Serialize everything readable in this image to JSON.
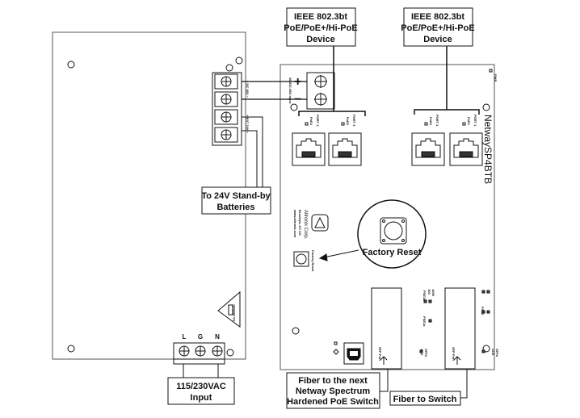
{
  "devices": [
    {
      "line1": "IEEE 802.3bt",
      "line2": "PoE/PoE+/Hi-PoE",
      "line3": "Device"
    },
    {
      "line1": "IEEE 802.3bt",
      "line2": "PoE/PoE+/Hi-PoE",
      "line3": "Device"
    }
  ],
  "psu": {
    "dc_label": "+ DC 36V −",
    "bat_label": "+ BAT 24V −",
    "fuse_label": "5A 250VAC",
    "ac_terminals": [
      "L",
      "G",
      "N"
    ]
  },
  "callouts": {
    "batteries_line1": "To 24V Stand-by",
    "batteries_line2": "Batteries",
    "ac_line1": "115/230VAC",
    "ac_line2": "Input",
    "fiber_next_line1": "Fiber to the next",
    "fiber_next_line2": "Netway Spectrum",
    "fiber_next_line3": "Hardened PoE Switch",
    "fiber_switch": "Fiber to Switch",
    "factory_reset": "Factory Reset"
  },
  "switch_board": {
    "model": "NetwaySP4BTB",
    "input_plus": "+",
    "input_minus": "−",
    "input_label": "36VDC-56V Input",
    "pwr_led": "PWR",
    "ports": [
      {
        "port": "PORT 4",
        "led": "PoE4"
      },
      {
        "port": "PORT 3",
        "led": "PoE3"
      },
      {
        "port": "PORT 2",
        "led": "PoE2"
      },
      {
        "port": "PORT 1",
        "led": "PoE1"
      }
    ],
    "company_line1": "Altronix Corp.",
    "company_line2": "Brooklyn, NY US",
    "company_line3": "www.altronix.com",
    "reset_label": "Factory Reset",
    "sfp_label": "SFP Port",
    "sfp_led_labels": [
      "SFP2",
      "AUX",
      "SFP2",
      "AUX",
      "1000",
      "100",
      "PSE1b",
      "PSE1a",
      "PSE2"
    ]
  }
}
